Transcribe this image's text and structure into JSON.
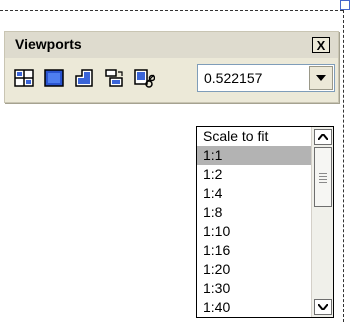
{
  "panel": {
    "title": "Viewports",
    "close_label": "X"
  },
  "toolbar": {
    "icons": [
      "viewports-dialog-icon",
      "single-viewport-icon",
      "polygonal-viewport-icon",
      "convert-object-to-viewport-icon",
      "clip-viewport-icon"
    ]
  },
  "scale_combo": {
    "value": "0.522157"
  },
  "dropdown": {
    "items": [
      "Scale to fit",
      "1:1",
      "1:2",
      "1:4",
      "1:8",
      "1:10",
      "1:16",
      "1:20",
      "1:30",
      "1:40"
    ],
    "selected_index": 1
  }
}
